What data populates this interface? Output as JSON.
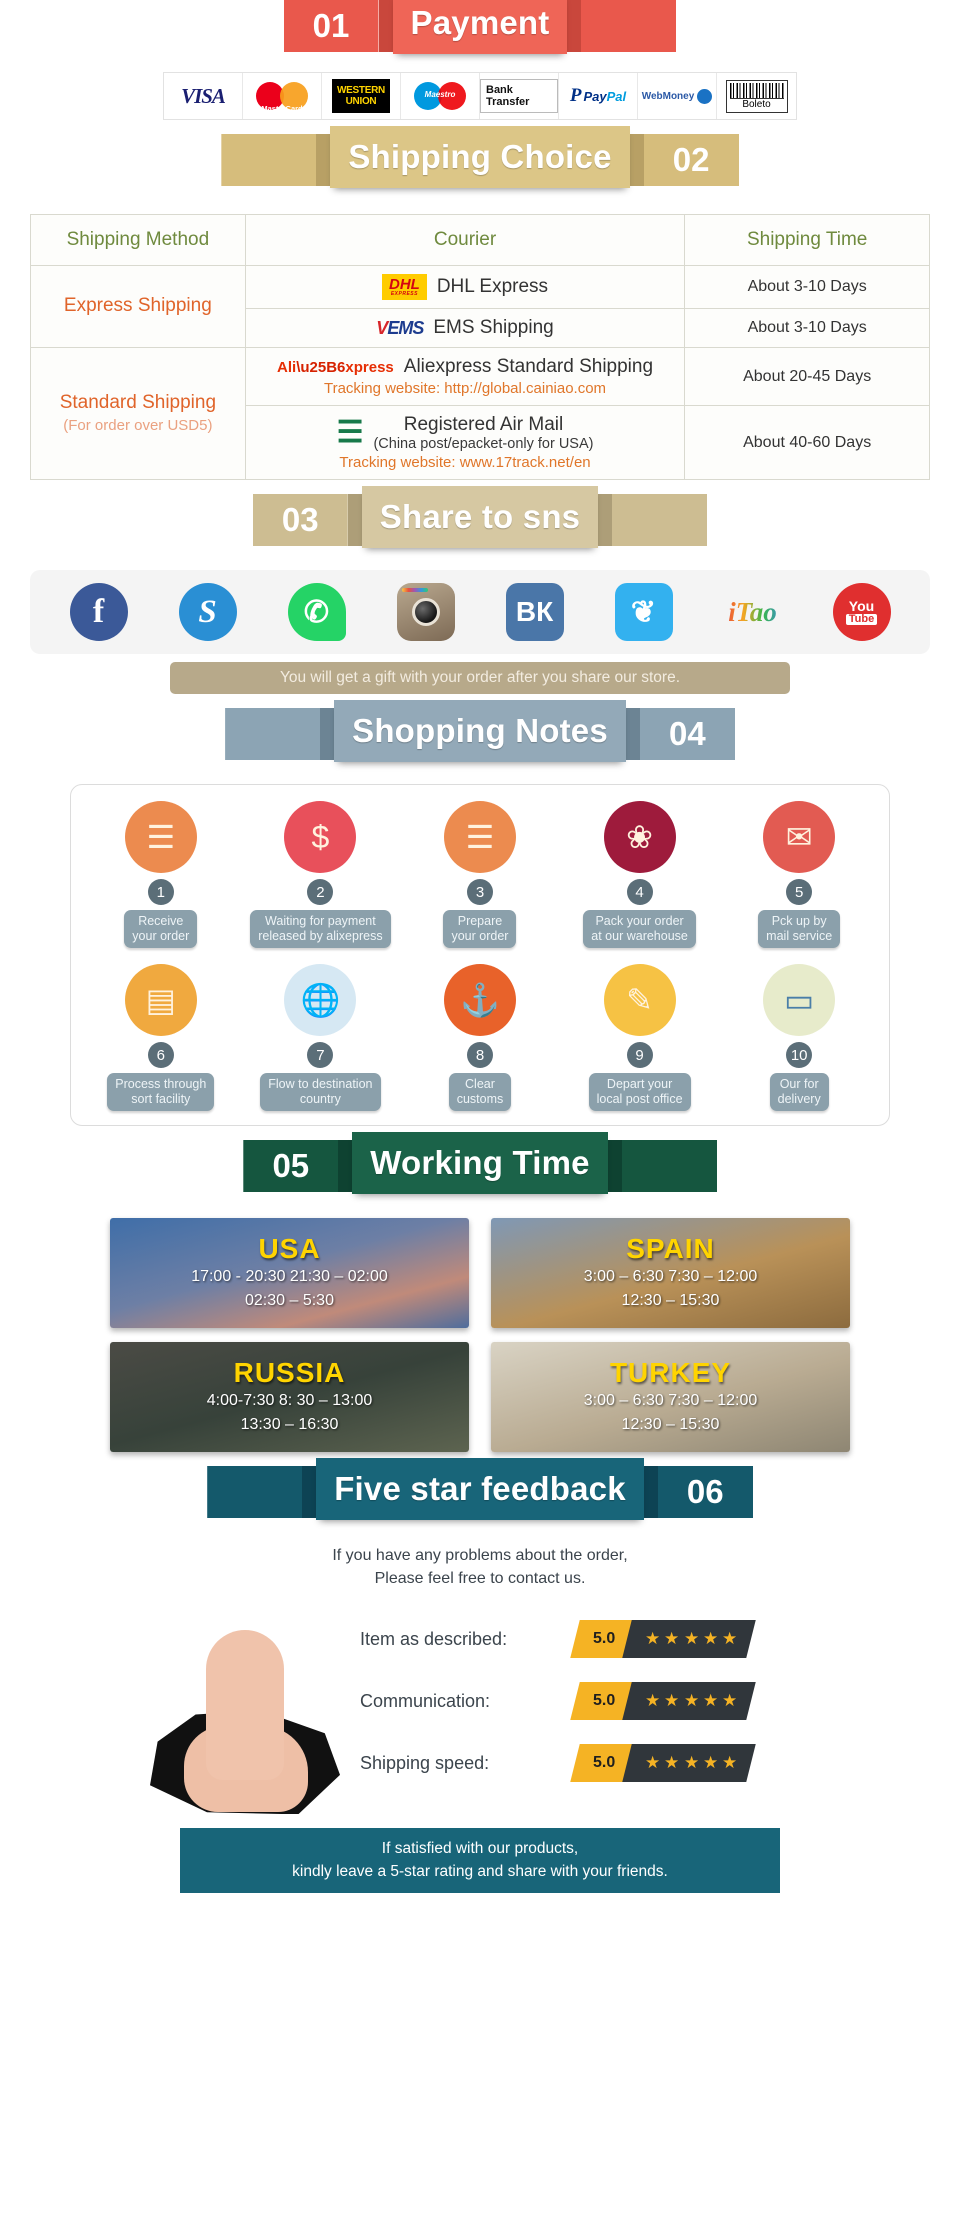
{
  "sections": [
    {
      "number": "01",
      "title": "Payment",
      "theme": "th-red",
      "num_side": "left"
    },
    {
      "number": "02",
      "title": "Shipping Choice",
      "theme": "th-gold",
      "num_side": "right"
    },
    {
      "number": "03",
      "title": "Share to sns",
      "theme": "th-sand",
      "num_side": "left"
    },
    {
      "number": "04",
      "title": "Shopping Notes",
      "theme": "th-slate",
      "num_side": "right"
    },
    {
      "number": "05",
      "title": "Working Time",
      "theme": "th-green",
      "num_side": "left"
    },
    {
      "number": "06",
      "title": "Five star feedback",
      "theme": "th-teal",
      "num_side": "right"
    }
  ],
  "payment": {
    "methods": [
      {
        "name": "visa-logo",
        "label": "VISA"
      },
      {
        "name": "mastercard-logo",
        "label": "MasterCard"
      },
      {
        "name": "western-union-logo",
        "label_line1": "WESTERN",
        "label_line2": "UNION"
      },
      {
        "name": "maestro-logo",
        "label": "Maestro"
      },
      {
        "name": "bank-transfer-logo",
        "label": "Bank Transfer"
      },
      {
        "name": "paypal-logo",
        "label_pay": "Pay",
        "label_pal": "Pal",
        "glyph": "P"
      },
      {
        "name": "webmoney-logo",
        "label": "WebMoney"
      },
      {
        "name": "boleto-logo",
        "label": "Boleto"
      }
    ]
  },
  "shipping": {
    "headers": [
      "Shipping Method",
      "Courier",
      "Shipping Time"
    ],
    "express": {
      "method": "Express Shipping",
      "rows": [
        {
          "logo": "dhl-logo",
          "logo_text": "DHL",
          "logo_sub": "EXPRESS",
          "courier": "DHL Express",
          "time": "About 3-10 Days"
        },
        {
          "logo": "ems-logo",
          "logo_text": "EMS",
          "courier": "EMS Shipping",
          "time": "About 3-10 Days"
        }
      ]
    },
    "standard": {
      "method": "Standard Shipping",
      "method_sub": "(For order over USD5)",
      "rows": [
        {
          "logo": "aliexpress-logo",
          "logo_text": "Ali",
          "logo_text2": "xpress",
          "courier": "Aliexpress Standard Shipping",
          "tracking": "Tracking website: http://global.cainiao.com",
          "time": "About 20-45 Days"
        },
        {
          "logo": "china-post-logo",
          "courier": "Registered Air Mail",
          "courier_sub": "(China post/epacket-only for USA)",
          "tracking": "Tracking website: www.17track.net/en",
          "time": "About 40-60 Days"
        }
      ]
    }
  },
  "social": {
    "icons": [
      {
        "name": "facebook-icon",
        "glyph": "f",
        "cls": "fb"
      },
      {
        "name": "skype-icon",
        "glyph": "S",
        "cls": "sk"
      },
      {
        "name": "whatsapp-icon",
        "glyph": "✆",
        "cls": "wa"
      },
      {
        "name": "instagram-icon",
        "glyph": "",
        "cls": "ig"
      },
      {
        "name": "vk-icon",
        "glyph": "ВК",
        "cls": "vk"
      },
      {
        "name": "twitter-icon",
        "glyph": "❦",
        "cls": "tw"
      },
      {
        "name": "itao-icon",
        "glyph": "iTao",
        "cls": "itao"
      },
      {
        "name": "youtube-icon",
        "glyph": "You",
        "glyph2": "Tube",
        "cls": "yt"
      }
    ],
    "gift_note": "You will get a gift with your order after you share our store."
  },
  "shopping_notes": {
    "steps": [
      {
        "n": "1",
        "label": "Receive\nyour order",
        "icon": "document-icon",
        "color": "#ec8b4f"
      },
      {
        "n": "2",
        "label": "Waiting for payment\nreleased by alixepress",
        "icon": "money-bag-icon",
        "color": "#e8505b"
      },
      {
        "n": "3",
        "label": "Prepare\nyour order",
        "icon": "document-icon",
        "color": "#ec8b4f"
      },
      {
        "n": "4",
        "label": "Pack your order\nat our warehouse",
        "icon": "gift-box-icon",
        "color": "#9e1b3c"
      },
      {
        "n": "5",
        "label": "Pck up by\nmail service",
        "icon": "mail-truck-icon",
        "color": "#e25b52"
      },
      {
        "n": "6",
        "label": "Process through\nsort facility",
        "icon": "hand-truck-icon",
        "color": "#f0a93f"
      },
      {
        "n": "7",
        "label": "Flow to destination\ncountry",
        "icon": "globe-icon",
        "color": "#d6e8f3"
      },
      {
        "n": "8",
        "label": "Clear\ncustoms",
        "icon": "anchor-icon",
        "color": "#e8622a"
      },
      {
        "n": "9",
        "label": "Depart your\nlocal post office",
        "icon": "clipboard-icon",
        "color": "#f6c244"
      },
      {
        "n": "10",
        "label": "Our for\ndelivery",
        "icon": "package-icon",
        "color": "#e7ebcb"
      }
    ]
  },
  "working_time": {
    "cards": [
      {
        "country": "USA",
        "cls": "tc-usa",
        "times": "17:00 - 20:30  21:30 – 02:00\n02:30 – 5:30"
      },
      {
        "country": "SPAIN",
        "cls": "tc-spain",
        "times": "3:00 – 6:30   7:30 – 12:00\n12:30 – 15:30"
      },
      {
        "country": "RUSSIA",
        "cls": "tc-russia",
        "times": "4:00-7:30   8: 30 – 13:00\n13:30 – 16:30"
      },
      {
        "country": "TURKEY",
        "cls": "tc-turkey",
        "times": "3:00 – 6:30   7:30 – 12:00\n12:30 – 15:30"
      }
    ]
  },
  "feedback": {
    "intro": "If you have any problems about the order,\nPlease feel free to contact us.",
    "ratings": [
      {
        "label": "Item as described:",
        "score": "5.0",
        "stars": 5
      },
      {
        "label": "Communication:",
        "score": "5.0",
        "stars": 5
      },
      {
        "label": "Shipping speed:",
        "score": "5.0",
        "stars": 5
      }
    ],
    "footer": "If satisfied with our products,\nkindly leave a 5-star rating and share with your friends."
  }
}
